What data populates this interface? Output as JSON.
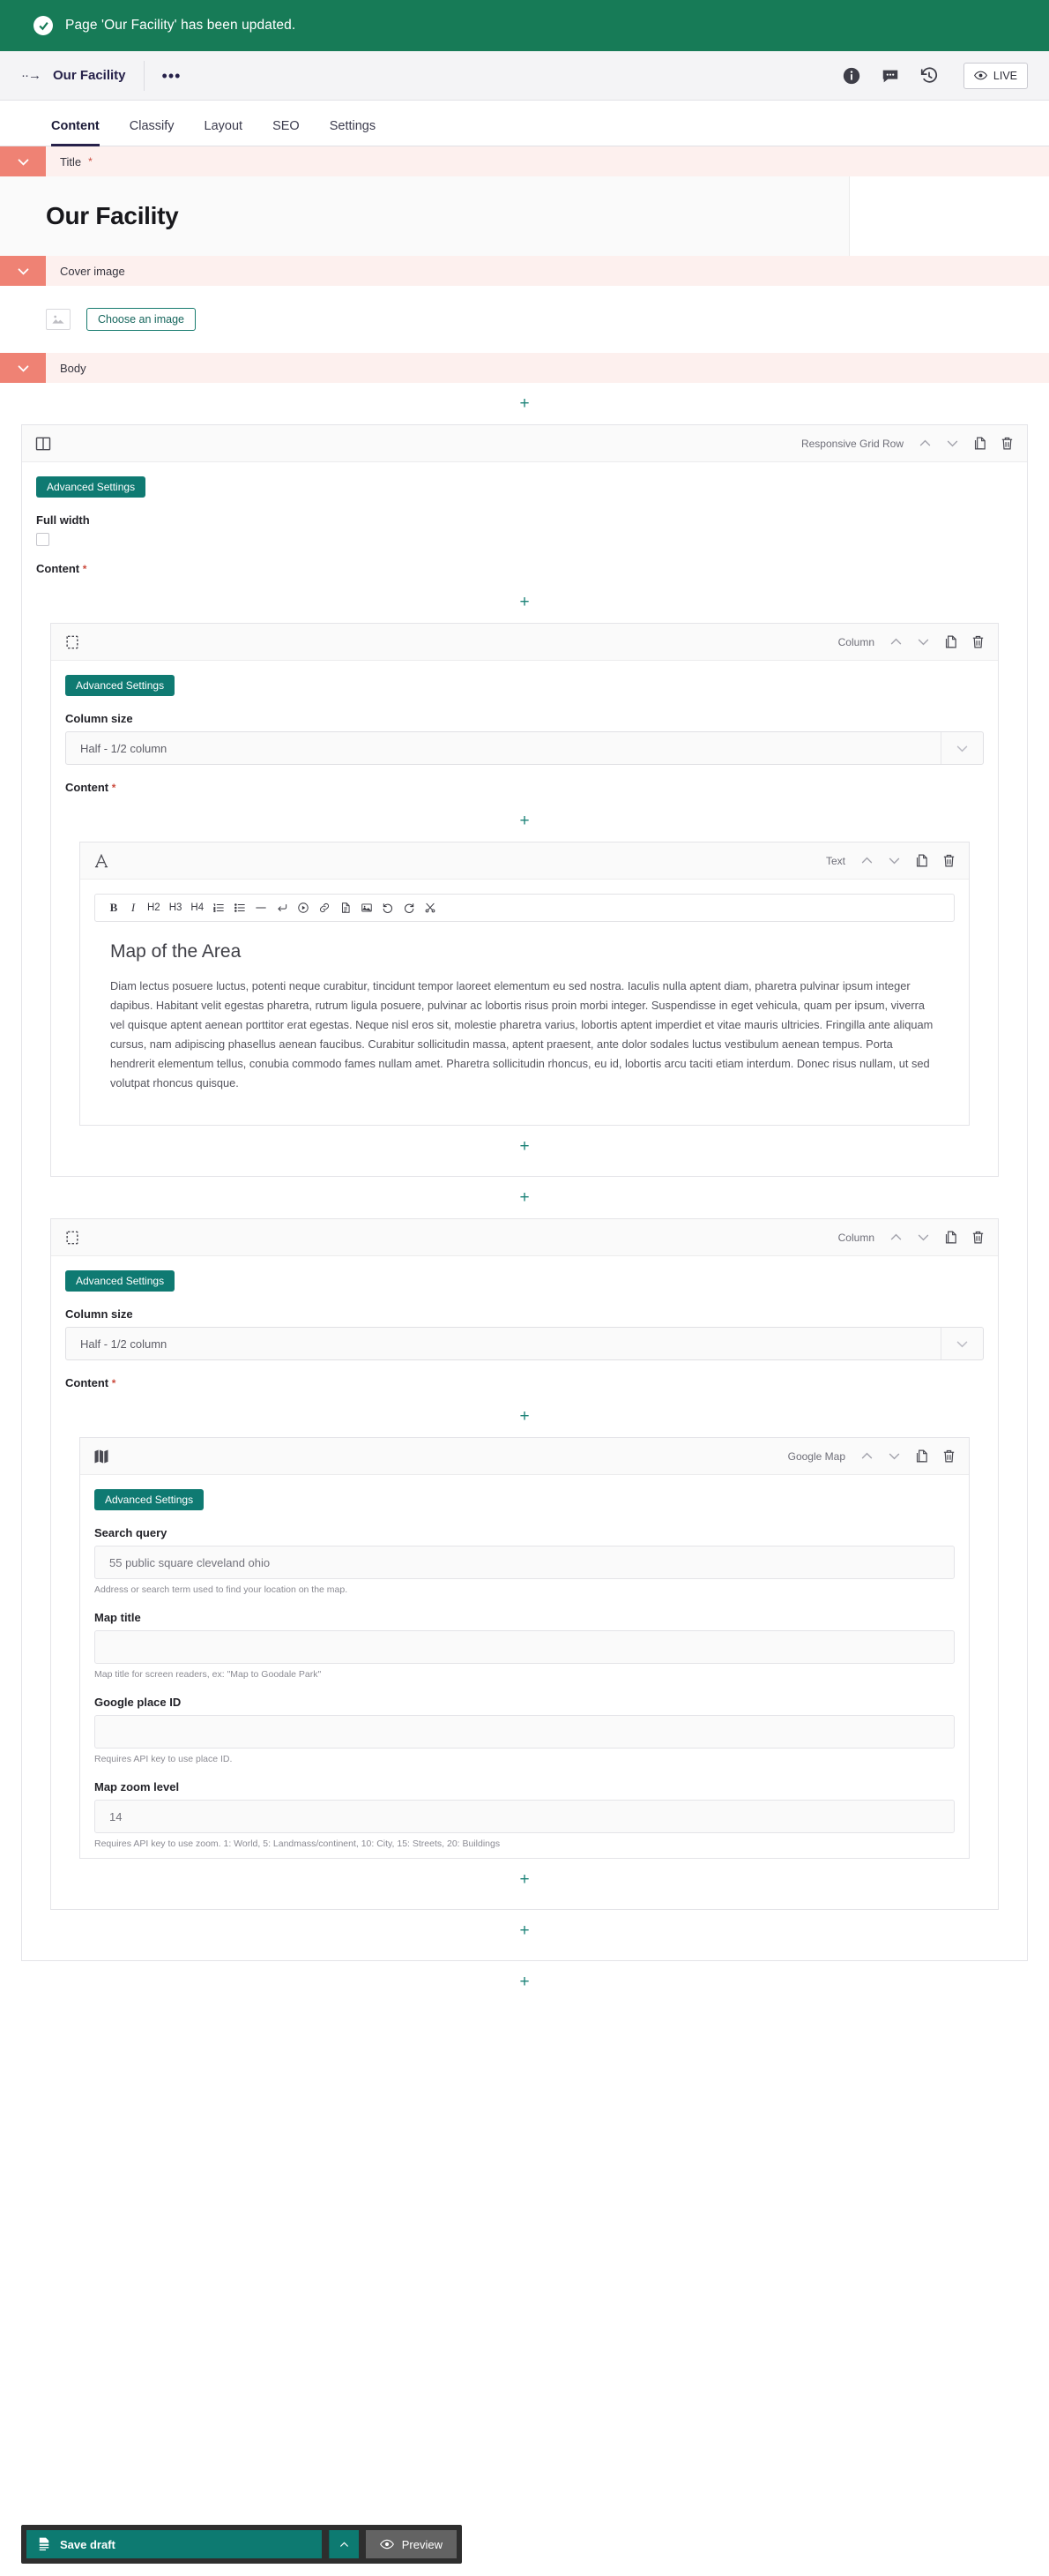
{
  "status": {
    "message": "Page 'Our Facility' has been updated.",
    "icon": "check-circle-icon",
    "bg": "#177b57"
  },
  "breadcrumb": {
    "back_glyph": "··→",
    "title": "Our Facility",
    "more_glyph": "•••"
  },
  "toolbar": {
    "icons": [
      "info-icon",
      "comment-icon",
      "history-icon"
    ],
    "live_label": "LIVE"
  },
  "tabs": [
    {
      "label": "Content",
      "active": true
    },
    {
      "label": "Classify",
      "active": false
    },
    {
      "label": "Layout",
      "active": false
    },
    {
      "label": "SEO",
      "active": false
    },
    {
      "label": "Settings",
      "active": false
    }
  ],
  "sections": {
    "title": {
      "label": "Title",
      "required": "*",
      "value": "Our Facility"
    },
    "cover_image": {
      "label": "Cover image",
      "button": "Choose an image"
    },
    "body": {
      "label": "Body"
    }
  },
  "grid_row": {
    "type": "Responsive Grid Row",
    "icon": "two-column-icon",
    "advanced_settings": "Advanced Settings",
    "full_width_label": "Full width",
    "full_width_checked": false,
    "content_label": "Content",
    "content_required": "*"
  },
  "column_left": {
    "type": "Column",
    "icon": "column-icon",
    "advanced_settings": "Advanced Settings",
    "column_size_label": "Column size",
    "column_size_value": "Half - 1/2 column",
    "content_label": "Content",
    "content_required": "*"
  },
  "column_right": {
    "type": "Column",
    "icon": "column-icon",
    "advanced_settings": "Advanced Settings",
    "column_size_label": "Column size",
    "column_size_value": "Half - 1/2 column",
    "content_label": "Content",
    "content_required": "*"
  },
  "text_block": {
    "type": "Text",
    "icon": "text-a-icon",
    "toolbar": [
      {
        "name": "bold-icon",
        "glyph": "B"
      },
      {
        "name": "italic-icon",
        "glyph": "I"
      },
      {
        "name": "heading-2-icon",
        "glyph": "H2"
      },
      {
        "name": "heading-3-icon",
        "glyph": "H3"
      },
      {
        "name": "heading-4-icon",
        "glyph": "H4"
      },
      {
        "name": "ordered-list-icon",
        "glyph": ""
      },
      {
        "name": "unordered-list-icon",
        "glyph": ""
      },
      {
        "name": "horizontal-rule-icon",
        "glyph": ""
      },
      {
        "name": "line-break-icon",
        "glyph": ""
      },
      {
        "name": "video-icon",
        "glyph": ""
      },
      {
        "name": "link-icon",
        "glyph": ""
      },
      {
        "name": "document-icon",
        "glyph": ""
      },
      {
        "name": "image-icon",
        "glyph": ""
      },
      {
        "name": "undo-icon",
        "glyph": ""
      },
      {
        "name": "redo-icon",
        "glyph": ""
      },
      {
        "name": "scissors-icon",
        "glyph": ""
      }
    ],
    "heading": "Map of the Area",
    "paragraph": "Diam lectus posuere luctus, potenti neque curabitur, tincidunt tempor laoreet elementum eu sed nostra. Iaculis nulla aptent diam, pharetra pulvinar ipsum integer dapibus. Habitant velit egestas pharetra, rutrum ligula posuere, pulvinar ac lobortis risus proin morbi integer. Suspendisse in eget vehicula, quam per ipsum, viverra vel quisque aptent aenean porttitor erat egestas. Neque nisl eros sit, molestie pharetra varius, lobortis aptent imperdiet et vitae mauris ultricies. Fringilla ante aliquam cursus, nam adipiscing phasellus aenean faucibus. Curabitur sollicitudin massa, aptent praesent, ante dolor sodales luctus vestibulum aenean tempus. Porta hendrerit elementum tellus, conubia commodo fames nullam amet. Pharetra sollicitudin rhoncus, eu id, lobortis arcu taciti etiam interdum. Donec risus nullam, ut sed volutpat rhoncus quisque."
  },
  "map_block": {
    "type": "Google Map",
    "icon": "map-icon",
    "advanced_settings": "Advanced Settings",
    "fields": [
      {
        "label": "Search query",
        "value": "55 public square cleveland ohio",
        "help": "Address or search term used to find your location on the map."
      },
      {
        "label": "Map title",
        "value": "",
        "help": "Map title for screen readers, ex: \"Map to Goodale Park\""
      },
      {
        "label": "Google place ID",
        "value": "",
        "help": "Requires API key to use place ID."
      },
      {
        "label": "Map zoom level",
        "value": "14",
        "help": "Requires API key to use zoom. 1: World, 5: Landmass/continent, 10: City, 15: Streets, 20: Buildings"
      }
    ]
  },
  "add_button_glyph": "+",
  "actions": {
    "save_label": "Save draft",
    "save_icon": "draft-document-icon",
    "caret_icon": "chevron-up-icon",
    "preview_label": "Preview",
    "preview_icon": "eye-icon"
  },
  "colors": {
    "success_green": "#177b57",
    "teal": "#0f7a72",
    "section_coral": "#ef8274",
    "section_bg": "#fdf0ee",
    "accent_dark": "#26214a"
  }
}
